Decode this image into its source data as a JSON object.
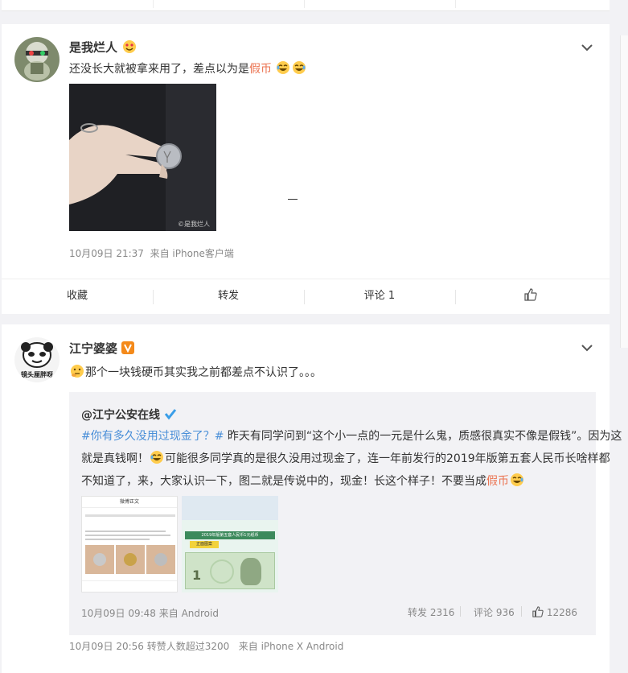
{
  "post1": {
    "username": "是我烂人",
    "text_before": "还没长大就被拿来用了，差点以为是",
    "text_highlight": "假币",
    "photo_watermark": "©是我烂人",
    "timestamp": "10月09日 21:37",
    "source": "来自 iPhone客户端",
    "actions": {
      "favorite": "收藏",
      "repost": "转发",
      "comment": "评论 1",
      "like": ""
    }
  },
  "post2": {
    "username": "江宁婆婆",
    "avatar_text": "镜头厘胖呀",
    "text": "那个一块钱硬币其实我之前都差点不认识了。。。",
    "repost": {
      "author": "@江宁公安在线",
      "hashtag": "#你有多久没用过现金了？#",
      "line1_rest": " 昨天有同学问到“这个小一点的一元是什么鬼，质感很真实不像是假钱”。因为这",
      "line2_a": "就是真钱啊！",
      "line2_b": "可能很多同学真的是很久没用过现金了，连一年前发行的2019年版第五套人民币长啥样都",
      "line3": "不知道了，来，大家认识一下，图二就是传说中的，现金！长这个样子！不要当成",
      "line3_highlight": "假币",
      "thumb1_title": "微博正文",
      "thumb2_banner": "2019年版第五套人民币1元纸币",
      "thumb2_tag": "正面图案",
      "timestamp": "10月09日 09:48",
      "source": "来自 Android",
      "repost_count": "转发 2316",
      "comment_count": "评论 936",
      "like_count": "12286"
    },
    "footer_time": "10月09日 20:56",
    "footer_info": "转赞人数超过3200",
    "footer_source": "来自 iPhone X Android"
  },
  "colors": {
    "highlight": "#eb7350",
    "link": "#4a8fd8",
    "meta": "#888888",
    "verified": "#f48a1a",
    "verified_blue": "#3a9ee8"
  }
}
